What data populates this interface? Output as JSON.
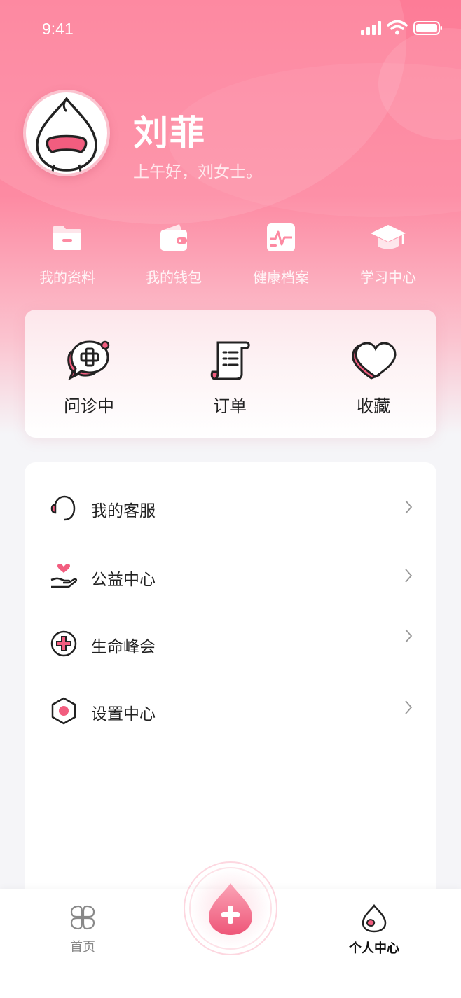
{
  "status_bar": {
    "time": "9:41"
  },
  "profile": {
    "name": "刘菲",
    "greeting": "上午好，刘女士。"
  },
  "quick_actions": [
    {
      "label": "我的资料",
      "icon": "folder-icon"
    },
    {
      "label": "我的钱包",
      "icon": "wallet-icon"
    },
    {
      "label": "健康档案",
      "icon": "health-record-icon"
    },
    {
      "label": "学习中心",
      "icon": "graduation-cap-icon"
    }
  ],
  "services": [
    {
      "label": "问诊中",
      "icon": "consultation-chat-icon"
    },
    {
      "label": "订单",
      "icon": "order-scroll-icon"
    },
    {
      "label": "收藏",
      "icon": "heart-icon"
    }
  ],
  "menu": [
    {
      "label": "我的客服",
      "icon": "headset-icon"
    },
    {
      "label": "公益中心",
      "icon": "charity-hand-heart-icon"
    },
    {
      "label": "生命峰会",
      "icon": "medical-cross-icon"
    },
    {
      "label": "设置中心",
      "icon": "settings-hexagon-icon"
    }
  ],
  "tabbar": {
    "home_label": "首页",
    "profile_label": "个人中心",
    "active": "profile"
  },
  "colors": {
    "accent": "#f25d7f",
    "header_gradient_top": "#fd7c97",
    "text_primary": "#222222"
  }
}
